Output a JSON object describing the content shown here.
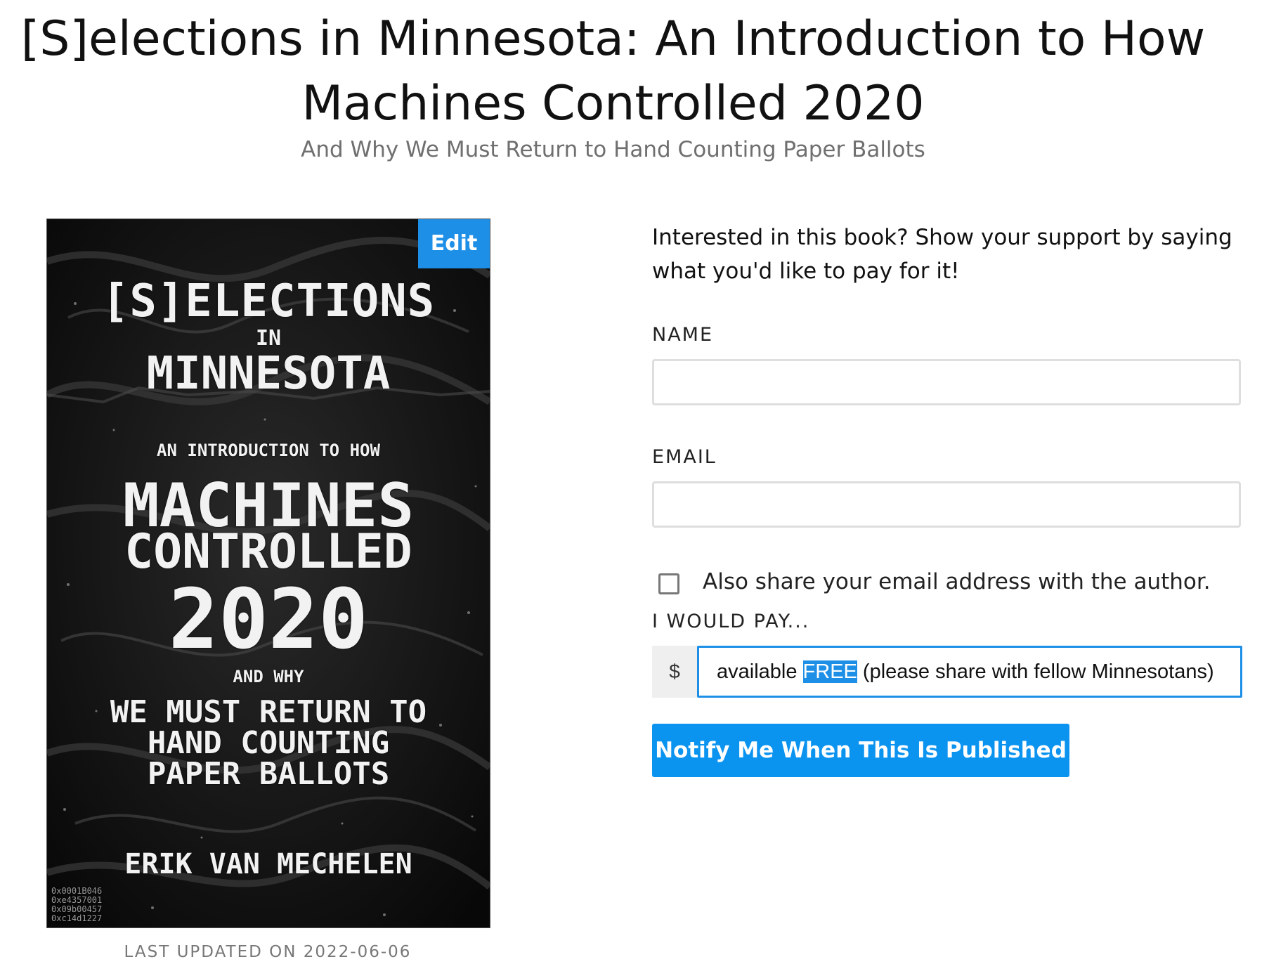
{
  "page": {
    "title": "[S]elections in Minnesota: An Introduction to How Machines Controlled 2020",
    "subtitle": "And Why We Must Return to Hand Counting Paper Ballots"
  },
  "cover": {
    "line_selections": "[S]ELECTIONS",
    "line_in": "IN",
    "line_minnesota": "MINNESOTA",
    "line_intro": "AN INTRODUCTION TO HOW",
    "line_machines": "MACHINES",
    "line_controlled": "CONTROLLED",
    "line_year": "2020",
    "line_and_why": "AND WHY",
    "line_must_return": "WE MUST RETURN TO\nHAND COUNTING\nPAPER BALLOTS",
    "author": "ERIK VAN MECHELEN",
    "corner_code": "0x0001B046\n0xe4357001\n0x09b00457\n0xc14d1227",
    "edit_label": "Edit"
  },
  "last_updated": "LAST UPDATED ON 2022-06-06",
  "form": {
    "intro": "Interested in this book? Show your support by saying what you'd like to pay for it!",
    "name_label": "NAME",
    "name_value": "",
    "email_label": "EMAIL",
    "email_value": "",
    "share_checkbox_label": "Also share your email address with the author.",
    "share_checked": false,
    "pay_label": "I WOULD PAY...",
    "currency_symbol": "$",
    "pay_text_before": "available ",
    "pay_text_selected": "FREE",
    "pay_text_after": " (please share with fellow Minnesotans)",
    "submit_label": "Notify Me When This Is Published"
  },
  "colors": {
    "accent": "#1e8fe6",
    "button": "#0b93f0",
    "cover_background": "#121212",
    "muted_text": "#6f6f6f"
  },
  "icons": {
    "checkbox": "empty-checkbox-icon"
  }
}
